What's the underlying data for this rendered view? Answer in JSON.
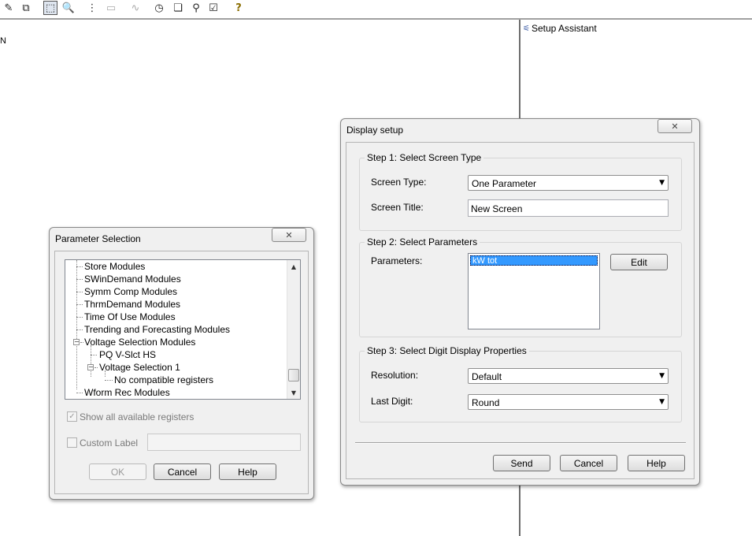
{
  "toolbar": {
    "icons": [
      "eraser-icon",
      "windows-icon",
      "select-icon",
      "zoom-icon",
      "tree-icon",
      "pages-icon",
      "chart-icon",
      "clock-icon",
      "stack-icon",
      "probe-icon",
      "check-icon",
      "help-icon"
    ],
    "glyphs": [
      "✎",
      "⧉",
      "⬚",
      "🔍",
      "⋮",
      "▭",
      "∿",
      "◷",
      "❏",
      "⚲",
      "☑",
      "?"
    ]
  },
  "setup_assistant": {
    "label": "Setup Assistant",
    "icon": "setup-assistant-icon"
  },
  "left_fragment": "N",
  "display_setup": {
    "title": "Display setup",
    "close_glyph": "✕",
    "step1": {
      "title": "Step 1: Select Screen Type",
      "screen_type_label": "Screen Type:",
      "screen_type_value": "One Parameter",
      "screen_title_label": "Screen Title:",
      "screen_title_value": "New Screen"
    },
    "step2": {
      "title": "Step 2: Select Parameters",
      "parameters_label": "Parameters:",
      "parameters": [
        "kW tot"
      ],
      "edit_label": "Edit"
    },
    "step3": {
      "title": "Step 3: Select Digit Display Properties",
      "resolution_label": "Resolution:",
      "resolution_value": "Default",
      "last_digit_label": "Last Digit:",
      "last_digit_value": "Round"
    },
    "buttons": {
      "send": "Send",
      "cancel": "Cancel",
      "help": "Help"
    }
  },
  "parameter_selection": {
    "title": "Parameter Selection",
    "close_glyph": "✕",
    "tree": [
      {
        "label": "Store Modules",
        "level": 0
      },
      {
        "label": "SWinDemand Modules",
        "level": 0
      },
      {
        "label": "Symm Comp Modules",
        "level": 0
      },
      {
        "label": "ThrmDemand Modules",
        "level": 0
      },
      {
        "label": "Time Of Use Modules",
        "level": 0
      },
      {
        "label": "Trending and Forecasting Modules",
        "level": 0
      },
      {
        "label": "Voltage Selection Modules",
        "level": 0
      },
      {
        "label": "PQ V-Slct HS",
        "level": 1
      },
      {
        "label": "Voltage Selection 1",
        "level": 1
      },
      {
        "label": "No compatible registers",
        "level": 2
      },
      {
        "label": "Wform Rec Modules",
        "level": 0
      }
    ],
    "show_all_label": "Show all available registers",
    "show_all_checked": true,
    "custom_label": "Custom Label",
    "custom_label_value": "",
    "buttons": {
      "ok": "OK",
      "cancel": "Cancel",
      "help": "Help"
    }
  }
}
